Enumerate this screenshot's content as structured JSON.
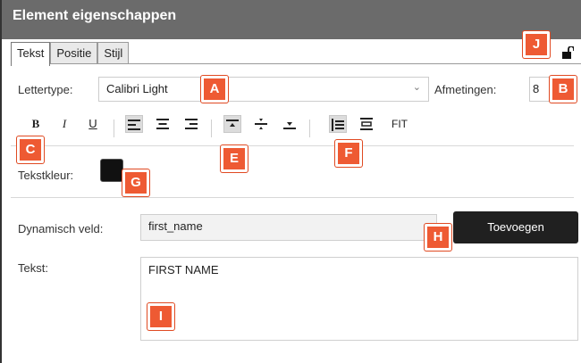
{
  "window": {
    "title": "Element eigenschappen"
  },
  "tabs": [
    {
      "label": "Tekst",
      "active": true
    },
    {
      "label": "Positie",
      "active": false
    },
    {
      "label": "Stijl",
      "active": false
    }
  ],
  "font": {
    "label": "Lettertype:",
    "value": "Calibri Light",
    "size_label": "Afmetingen:",
    "size_value": "8"
  },
  "toolbar": {
    "bold": "B",
    "italic": "I",
    "underline": "U",
    "fit": "FIT"
  },
  "color": {
    "label": "Tekstkleur:",
    "value": "#111111"
  },
  "dynamic": {
    "label": "Dynamisch veld:",
    "value": "first_name",
    "add_button": "Toevoegen"
  },
  "text": {
    "label": "Tekst:",
    "value": "FIRST NAME"
  },
  "annotations": {
    "A": "A",
    "B": "B",
    "C": "C",
    "E": "E",
    "F": "F",
    "G": "G",
    "H": "H",
    "I": "I",
    "J": "J"
  },
  "colors": {
    "titlebar": "#6b6b6b",
    "badge": "#ee5a33",
    "button_dark": "#202020"
  },
  "icons": [
    "lock-open-icon",
    "chevron-down-icon",
    "align-left-icon",
    "align-center-icon",
    "align-right-icon",
    "valign-top-icon",
    "valign-middle-icon",
    "valign-bottom-icon",
    "line-spacing-icon",
    "text-wrap-icon"
  ]
}
